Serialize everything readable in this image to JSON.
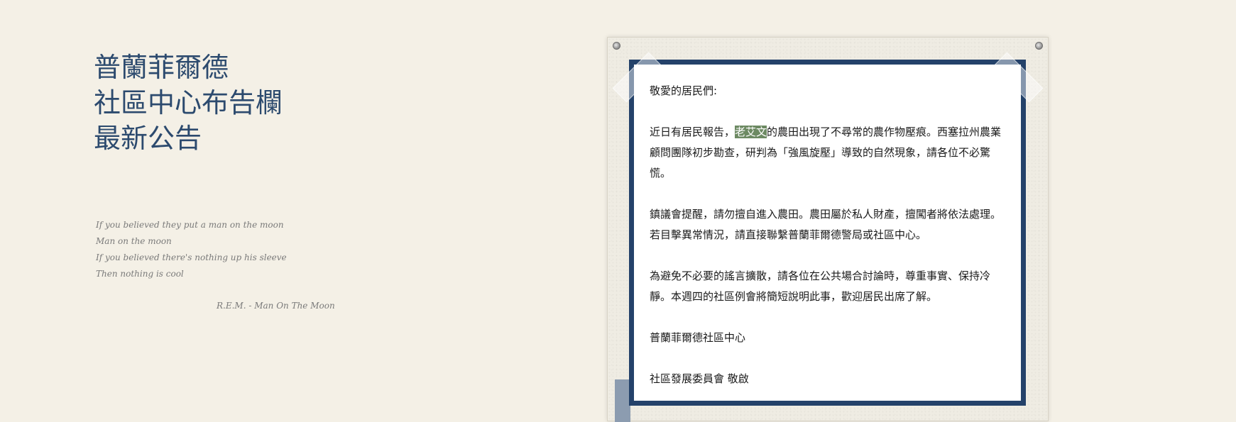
{
  "title": {
    "line1": "普蘭菲爾德",
    "line2": "社區中心布告欄",
    "line3": "最新公告"
  },
  "lyrics": {
    "lines": [
      "If you believed they put a man on the moon",
      "Man on the moon",
      "If you believed there's nothing up his sleeve",
      "Then nothing is cool"
    ],
    "credit": "R.E.M. - Man On The Moon"
  },
  "notice": {
    "greeting": "敬愛的居民們:",
    "p1_before": "近日有居民報告，",
    "p1_highlight": "老艾文",
    "p1_after": "的農田出現了不尋常的農作物壓痕。西塞拉州農業顧問團隊初步勘查，研判為「強風旋壓」導致的自然現象，請各位不必驚慌。",
    "p2": "鎮議會提醒，請勿擅自進入農田。農田屬於私人財產，擅闖者將依法處理。若目擊異常情況，請直接聯繫普蘭菲爾德警局或社區中心。",
    "p3": "為避免不必要的謠言擴散，請各位在公共場合討論時，尊重事實、保持冷靜。本週四的社區例會將簡短說明此事，歡迎居民出席了解。",
    "signature1": "普蘭菲爾德社區中心",
    "signature2": "社區發展委員會 敬啟"
  },
  "colors": {
    "background": "#f4f0e6",
    "title": "#2c4a6e",
    "notice_border": "#24426a",
    "highlight": "#6d8a63"
  }
}
